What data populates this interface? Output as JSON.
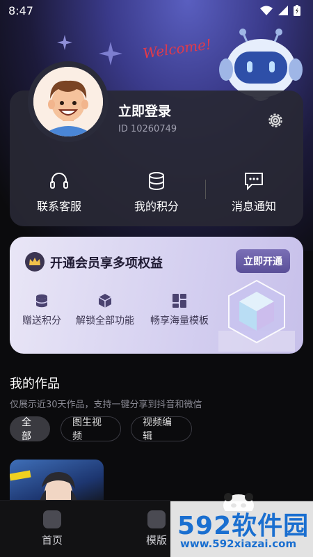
{
  "status_bar": {
    "time": "8:47"
  },
  "decoration": {
    "welcome_text": "Welcome!"
  },
  "profile": {
    "login_label": "立即登录",
    "user_id": "ID 10260749"
  },
  "quick_actions": [
    {
      "label": "联系客服",
      "icon": "headset-icon"
    },
    {
      "label": "我的积分",
      "icon": "coins-icon"
    },
    {
      "label": "消息通知",
      "icon": "message-icon"
    }
  ],
  "vip": {
    "title": "开通会员享多项权益",
    "button_label": "立即开通",
    "perks": [
      {
        "label": "赠送积分",
        "icon": "coins-icon"
      },
      {
        "label": "解锁全部功能",
        "icon": "cube-icon"
      },
      {
        "label": "畅享海量模板",
        "icon": "grid-icon"
      }
    ]
  },
  "works": {
    "title": "我的作品",
    "subtitle": "仅展示近30天作品，支持一键分享到抖音和微信",
    "filters": [
      {
        "label": "全部",
        "active": true
      },
      {
        "label": "图生视频",
        "active": false
      },
      {
        "label": "视频编辑",
        "active": false
      }
    ]
  },
  "tabbar": {
    "tabs": [
      {
        "label": "首页",
        "icon": "home-icon"
      },
      {
        "label": "模版",
        "icon": "template-icon"
      }
    ]
  },
  "watermark": {
    "brand": "592软件园",
    "url": "www.592xiazai.com"
  },
  "colors": {
    "background": "#0b0b0d",
    "card": "#28283a",
    "vip_card": "#d4cff0",
    "vip_button": "#5a4f98",
    "watermark_text": "#1a6fd0"
  }
}
